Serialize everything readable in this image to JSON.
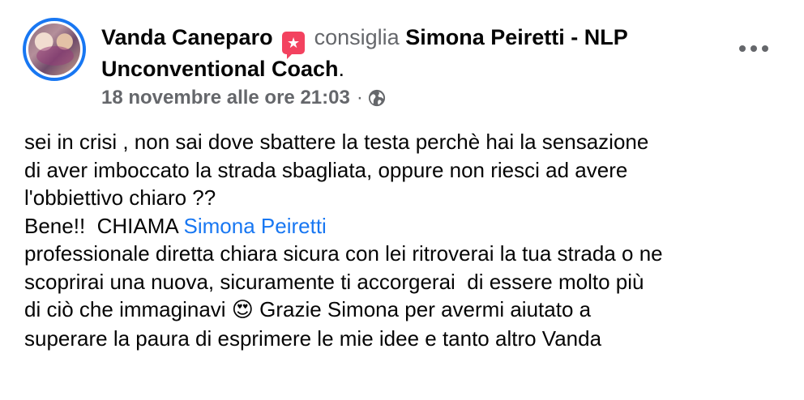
{
  "post": {
    "author": "Vanda Caneparo",
    "verb": "consiglia",
    "page_name": "Simona Peiretti - NLP Unconventional Coach",
    "punctuation": ".",
    "timestamp": "18 novembre alle ore 21:03",
    "separator": "·",
    "privacy_icon": "globe-icon",
    "recommend_icon": "star-badge-icon",
    "more_icon": "more-options-icon",
    "body": {
      "line1": "sei in crisi , non sai dove sbattere la testa perchè hai la sensazione",
      "line2": "di aver imboccato la strada sbagliata, oppure non riesci ad avere",
      "line3": "l'obbiettivo chiaro ??",
      "line4_prefix": "Bene!!  CHIAMA ",
      "mention": "Simona Peiretti",
      "line5": "professionale diretta chiara sicura con lei ritroverai la tua strada o ne",
      "line6": "scoprirai una nuova, sicuramente ti accorgerai  di essere molto più",
      "line7_prefix": "di ciò che immaginavi ",
      "emoji": "😍",
      "line7_suffix": " Grazie Simona per avermi aiutato a",
      "line8": "superare la paura di esprimere le mie idee e tanto altro Vanda"
    }
  },
  "colors": {
    "link": "#1877f2",
    "secondary": "#65676b",
    "badge": "#f3425f",
    "text": "#050505"
  }
}
